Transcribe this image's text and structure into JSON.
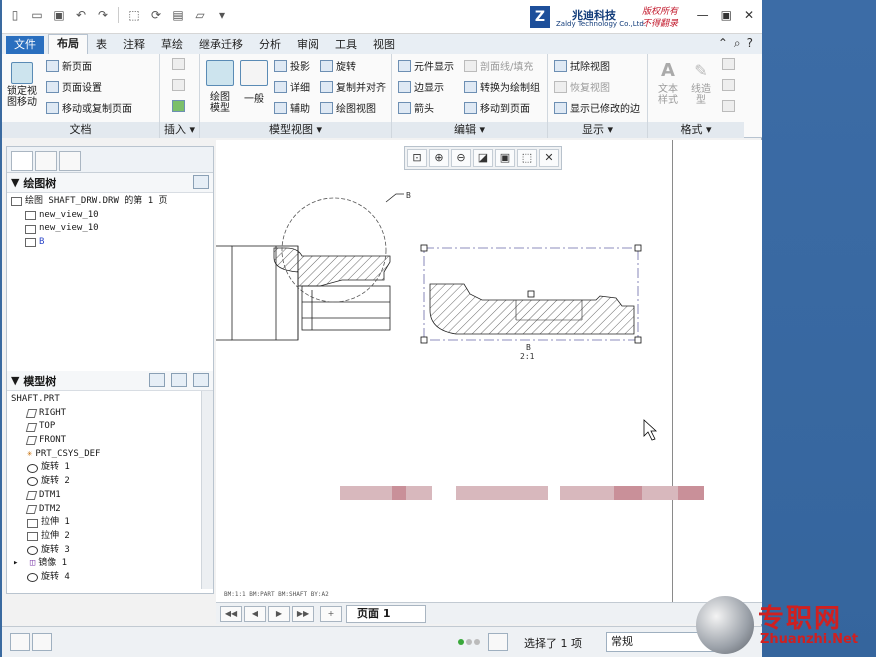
{
  "quick_access": [
    "new-icon",
    "open-icon",
    "save-icon",
    "undo-icon",
    "redo-icon",
    "select-icon",
    "regenerate-icon",
    "windows-icon",
    "close-window-icon",
    "more-icon"
  ],
  "brand": {
    "logo_letter": "Z",
    "name_cn": "兆迪科技",
    "name_en": "Zaldy Technology Co.,Ltd.",
    "slogan_1": "版权所有",
    "slogan_2": "不得翻录"
  },
  "tabs": [
    "文件",
    "布局",
    "表",
    "注释",
    "草绘",
    "继承迁移",
    "分析",
    "审阅",
    "工具",
    "视图"
  ],
  "active_tab": "布局",
  "ribbon": {
    "doc": {
      "label": "文档",
      "lock_label_1": "锁定视",
      "lock_label_2": "图移动",
      "new_page": "新页面",
      "page_setup": "页面设置",
      "move_copy_page": "移动或复制页面"
    },
    "insert": {
      "label": "插入"
    },
    "model_views": {
      "label": "模型视图",
      "drawing_model_1": "绘图",
      "drawing_model_2": "模型",
      "general": "一般",
      "projection": "投影",
      "detail": "详细",
      "auxiliary": "辅助",
      "revolve": "旋转",
      "copy_align": "复制并对齐",
      "drawing_view": "绘图视图"
    },
    "edit": {
      "label": "编辑",
      "element_display": "元件显示",
      "edge_display": "边显示",
      "arrow": "箭头",
      "section_fill": "剖面线/填充",
      "convert_draft": "转换为绘制组",
      "move_to_page": "移动到页面"
    },
    "display": {
      "label": "显示",
      "erase_view": "拭除视图",
      "restore_view": "恢复视图",
      "show_modified_edges": "显示已修改的边"
    },
    "format": {
      "label": "格式",
      "text_style_1": "文本",
      "text_style_2": "样式",
      "line_style_1": "线造",
      "line_style_2": "型"
    }
  },
  "drawing_tree": {
    "title": "绘图树",
    "items": [
      "绘图 SHAFT_DRW.DRW 的第 1 页",
      "new_view_10",
      "new_view_10",
      "B"
    ]
  },
  "model_tree": {
    "title": "模型树",
    "items": [
      "SHAFT.PRT",
      "RIGHT",
      "TOP",
      "FRONT",
      "PRT_CSYS_DEF",
      "旋转 1",
      "旋转 2",
      "DTM1",
      "DTM2",
      "拉伸 1",
      "拉伸 2",
      "旋转 3",
      "镜像 1",
      "旋转 4"
    ]
  },
  "canvas": {
    "detail_label": "B",
    "view_label": "B",
    "view_scale": "2:1",
    "footnote": "BM:1:1    BM:PART   BM:SHAFT  BY:A2"
  },
  "page_nav": {
    "page_label": "页面 1"
  },
  "status": {
    "selection": "选择了 1 项",
    "filter": "常规"
  },
  "watermark": {
    "cn": "专职网",
    "en": "Zhuanzhi.Net"
  },
  "colors": {
    "file_tab": "#2a6fbf",
    "desktop": "#3a6aa0",
    "watermark_red": "#d02020"
  }
}
